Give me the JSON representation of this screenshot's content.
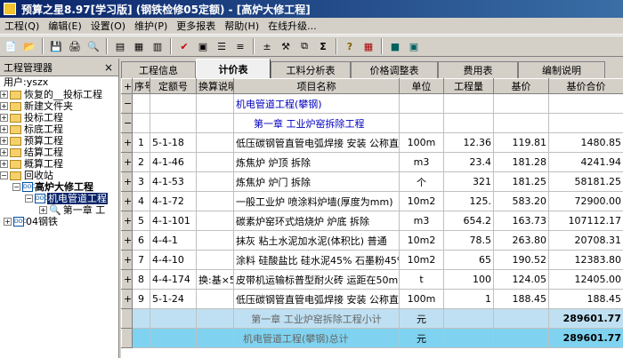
{
  "window": {
    "title": "预算之星8.97[学习版]  (钢铁检修05定额) - [高炉大修工程]"
  },
  "menu": [
    "工程(Q)",
    "编辑(E)",
    "设置(O)",
    "维护(P)",
    "更多报表",
    "帮助(H)",
    "在线升级..."
  ],
  "left_panel": {
    "title": "工程管理器",
    "close": "×",
    "user": "用户:yszx",
    "tree": [
      {
        "label": "恢复的__投标工程"
      },
      {
        "label": "新建文件夹"
      },
      {
        "label": "投标工程"
      },
      {
        "label": "标底工程"
      },
      {
        "label": "预算工程"
      },
      {
        "label": "结算工程"
      },
      {
        "label": "概算工程"
      },
      {
        "label": "回收站"
      }
    ],
    "project": "高炉大修工程",
    "subproject": "机电管道工程",
    "chapter": "第一章 工",
    "other": "04钢铁",
    "doc_badge": "DOC"
  },
  "tabs": [
    "工程信息",
    "计价表",
    "工料分析表",
    "价格调整表",
    "费用表",
    "编制说明"
  ],
  "table": {
    "headers": [
      "序号",
      "定额号",
      "换算说明",
      "项目名称",
      "单位",
      "工程量",
      "基价",
      "基价合价"
    ],
    "title_row": "机电管道工程(攀钢)",
    "chapter_row": "第一章 工业炉窑拆除工程",
    "rows": [
      {
        "seq": "1",
        "code": "5-1-18",
        "note": "",
        "name": "低压碳钢管直管电弧焊接  安装  公称直",
        "unit": "100m",
        "qty": "12.36",
        "price": "119.81",
        "total": "1480.85"
      },
      {
        "seq": "2",
        "code": "4-1-46",
        "note": "",
        "name": "炼焦炉  炉顶  拆除",
        "unit": "m3",
        "qty": "23.4",
        "price": "181.28",
        "total": "4241.94"
      },
      {
        "seq": "3",
        "code": "4-1-53",
        "note": "",
        "name": "炼焦炉  炉门  拆除",
        "unit": "个",
        "qty": "321",
        "price": "181.25",
        "total": "58181.25"
      },
      {
        "seq": "4",
        "code": "4-1-72",
        "note": "",
        "name": "一般工业炉  喷涂料炉墙(厚度为mm)",
        "unit": "10m2",
        "qty": "125.",
        "price": "583.20",
        "total": "72900.00"
      },
      {
        "seq": "5",
        "code": "4-1-101",
        "note": "",
        "name": "碳素炉窑环式焙烧炉  炉底  拆除",
        "unit": "m3",
        "qty": "654.2",
        "price": "163.73",
        "total": "107112.17"
      },
      {
        "seq": "6",
        "code": "4-4-1",
        "note": "",
        "name": "抹灰  粘土水泥加水泥(体积比)  普通",
        "unit": "10m2",
        "qty": "78.5",
        "price": "263.80",
        "total": "20708.31"
      },
      {
        "seq": "7",
        "code": "4-4-10",
        "note": "",
        "name": "涂料  硅酸盐比  硅水泥45% 石墨粉45% 石",
        "unit": "10m2",
        "qty": "65",
        "price": "190.52",
        "total": "12383.80"
      },
      {
        "seq": "8",
        "code": "4-4-174",
        "note": "换:基×5",
        "name": "皮带机运输标普型耐火砖  运距在50m以内",
        "unit": "t",
        "qty": "100",
        "price": "124.05",
        "total": "12405.00"
      },
      {
        "seq": "9",
        "code": "5-1-24",
        "note": "",
        "name": "低压碳钢管直管电弧焊接  安装  公称直",
        "unit": "100m",
        "qty": "1",
        "price": "188.45",
        "total": "188.45"
      }
    ],
    "subtotal": {
      "name": "第一章 工业炉窑拆除工程小计",
      "unit": "元",
      "total": "289601.77"
    },
    "grand_total": {
      "name": "机电管道工程(攀钢)总计",
      "unit": "元",
      "total": "289601.77"
    },
    "row_markers": {
      "plus": "+",
      "minus": "−"
    }
  }
}
